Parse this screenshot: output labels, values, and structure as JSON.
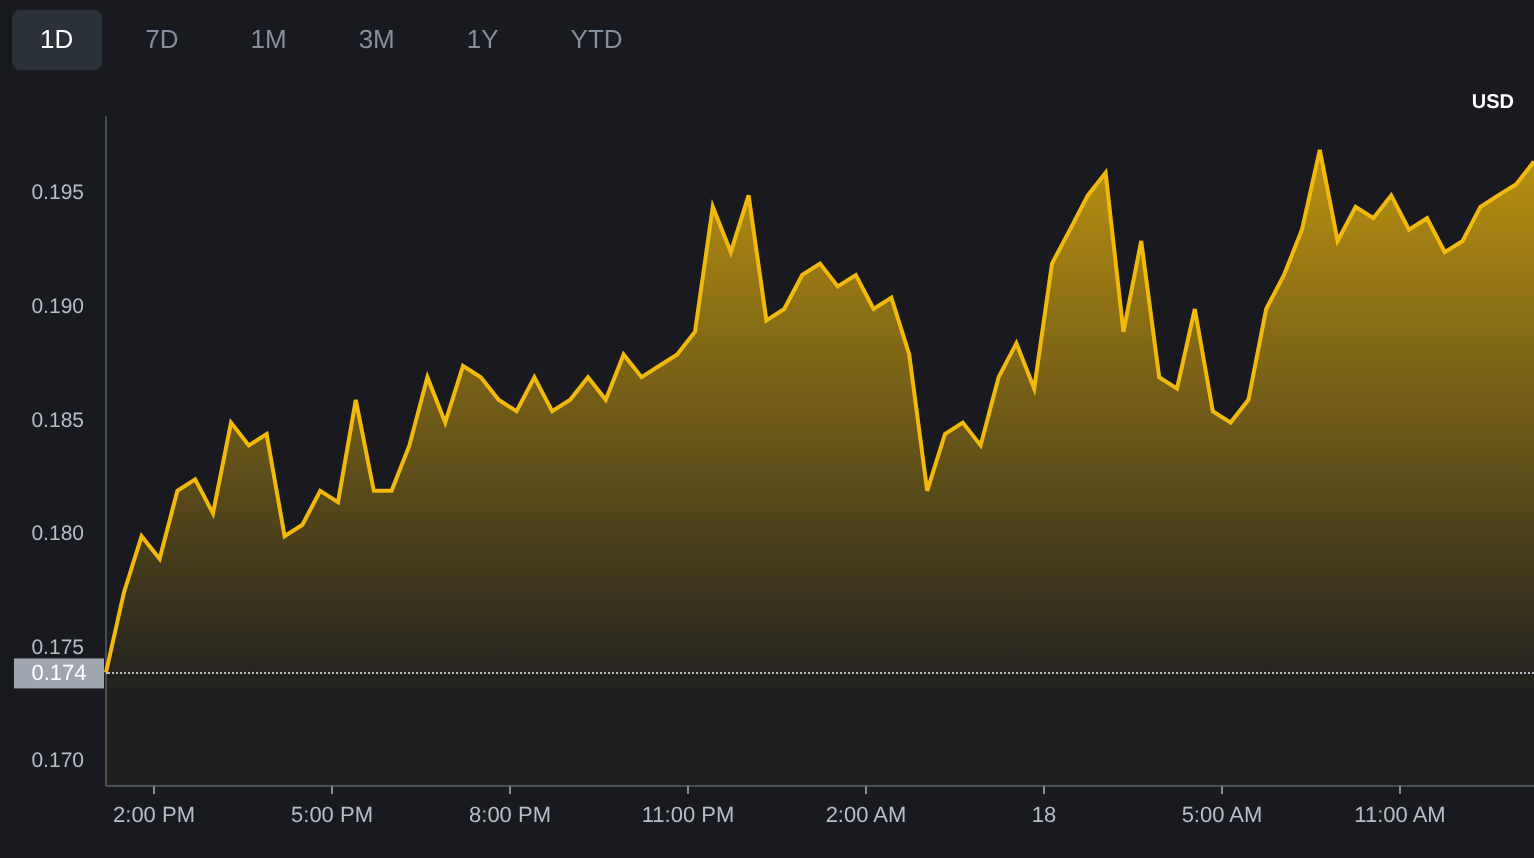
{
  "tabs": [
    {
      "label": "1D",
      "selected": true
    },
    {
      "label": "7D",
      "selected": false
    },
    {
      "label": "1M",
      "selected": false
    },
    {
      "label": "3M",
      "selected": false
    },
    {
      "label": "1Y",
      "selected": false
    },
    {
      "label": "YTD",
      "selected": false
    }
  ],
  "currency": "USD",
  "price_tag": "0.174",
  "time_axis": [
    "2:00 PM",
    "5:00 PM",
    "8:00 PM",
    "11:00 PM",
    "2:00 AM",
    "18",
    "5:00 AM",
    "11:00 AM"
  ],
  "chart_data": {
    "type": "area",
    "ylim": [
      0.169,
      0.1985
    ],
    "yticks": [
      {
        "value": 0.17,
        "label": "0.170"
      },
      {
        "value": 0.175,
        "label": "0.175"
      },
      {
        "value": 0.18,
        "label": "0.180"
      },
      {
        "value": 0.185,
        "label": "0.185"
      },
      {
        "value": 0.19,
        "label": "0.190"
      },
      {
        "value": 0.195,
        "label": "0.195"
      }
    ],
    "series": [
      {
        "color": "#f0b90b",
        "values": [
          0.174,
          0.1775,
          0.18,
          0.179,
          0.182,
          0.1825,
          0.181,
          0.185,
          0.184,
          0.1845,
          0.18,
          0.1805,
          0.182,
          0.1815,
          0.186,
          0.182,
          0.182,
          0.184,
          0.187,
          0.185,
          0.1875,
          0.187,
          0.186,
          0.1855,
          0.187,
          0.1855,
          0.186,
          0.187,
          0.186,
          0.188,
          0.187,
          0.1875,
          0.188,
          0.189,
          0.1945,
          0.1925,
          0.195,
          0.1895,
          0.19,
          0.1915,
          0.192,
          0.191,
          0.1915,
          0.19,
          0.1905,
          0.188,
          0.182,
          0.1845,
          0.185,
          0.184,
          0.187,
          0.1885,
          0.1865,
          0.192,
          0.1935,
          0.195,
          0.196,
          0.189,
          0.193,
          0.187,
          0.1865,
          0.19,
          0.1855,
          0.185,
          0.186,
          0.19,
          0.1915,
          0.1935,
          0.197,
          0.193,
          0.1945,
          0.194,
          0.195,
          0.1935,
          0.194,
          0.1925,
          0.193,
          0.1945,
          0.195,
          0.1955,
          0.1965
        ]
      }
    ]
  }
}
